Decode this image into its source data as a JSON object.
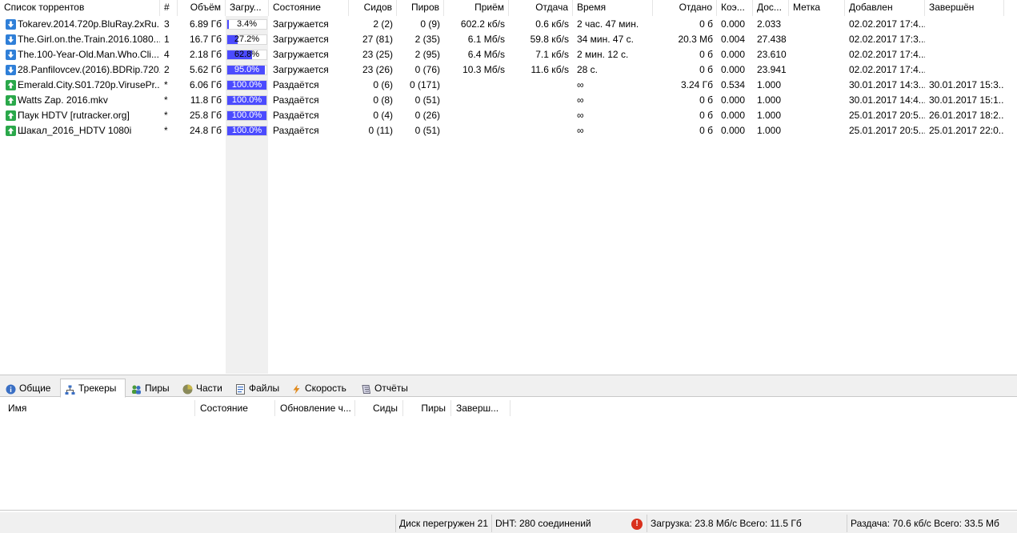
{
  "columns": {
    "name": "Список торрентов",
    "queue": "#",
    "size": "Объём",
    "progress": "Загру...",
    "status": "Состояние",
    "seeds": "Сидов",
    "peers": "Пиров",
    "down_speed": "Приём",
    "up_speed": "Отдача",
    "time": "Время",
    "uploaded": "Отдано",
    "ratio": "Коэ...",
    "avail": "Дос...",
    "label": "Метка",
    "added": "Добавлен",
    "completed": "Завершён"
  },
  "torrents": [
    {
      "name": "Tokarev.2014.720p.BluRay.2xRu...",
      "icon": "download-icon",
      "queue": "3",
      "size": "6.89 Гб",
      "progress": 0.034,
      "progress_text": "3.4%",
      "status": "Загружается",
      "seeds": "2 (2)",
      "peers": "0 (9)",
      "down_speed": "602.2 кб/s",
      "up_speed": "0.6 кб/s",
      "time": "2 час. 47 мин.",
      "uploaded": "0 б",
      "ratio": "0.000",
      "avail": "2.033",
      "label": "",
      "added": "02.02.2017 17:4...",
      "completed": ""
    },
    {
      "name": "The.Girl.on.the.Train.2016.1080...",
      "icon": "download-icon",
      "queue": "1",
      "size": "16.7 Гб",
      "progress": 0.272,
      "progress_text": "27.2%",
      "status": "Загружается",
      "seeds": "27 (81)",
      "peers": "2 (35)",
      "down_speed": "6.1 Мб/s",
      "up_speed": "59.8 кб/s",
      "time": "34 мин. 47 с.",
      "uploaded": "20.3 Мб",
      "ratio": "0.004",
      "avail": "27.438",
      "label": "",
      "added": "02.02.2017 17:3...",
      "completed": ""
    },
    {
      "name": "The.100-Year-Old.Man.Who.Cli...",
      "icon": "download-icon",
      "queue": "4",
      "size": "2.18 Гб",
      "progress": 0.628,
      "progress_text": "62.8%",
      "status": "Загружается",
      "seeds": "23 (25)",
      "peers": "2 (95)",
      "down_speed": "6.4 Мб/s",
      "up_speed": "7.1 кб/s",
      "time": "2 мин. 12 с.",
      "uploaded": "0 б",
      "ratio": "0.000",
      "avail": "23.610",
      "label": "",
      "added": "02.02.2017 17:4...",
      "completed": ""
    },
    {
      "name": "28.Panfilovcev.(2016).BDRip.720...",
      "icon": "download-icon",
      "queue": "2",
      "size": "5.62 Гб",
      "progress": 0.95,
      "progress_text": "95.0%",
      "status": "Загружается",
      "seeds": "23 (26)",
      "peers": "0 (76)",
      "down_speed": "10.3 Мб/s",
      "up_speed": "11.6 кб/s",
      "time": "28 с.",
      "uploaded": "0 б",
      "ratio": "0.000",
      "avail": "23.941",
      "label": "",
      "added": "02.02.2017 17:4...",
      "completed": ""
    },
    {
      "name": "Emerald.City.S01.720p.VirusePr...",
      "icon": "seeding-icon",
      "queue": "*",
      "size": "6.06 Гб",
      "progress": 1.0,
      "progress_text": "100.0%",
      "status": "Раздаётся",
      "seeds": "0 (6)",
      "peers": "0 (171)",
      "down_speed": "",
      "up_speed": "",
      "time": "∞",
      "uploaded": "3.24 Гб",
      "ratio": "0.534",
      "avail": "1.000",
      "label": "",
      "added": "30.01.2017 14:3...",
      "completed": "30.01.2017 15:3..."
    },
    {
      "name": "Watts Zap. 2016.mkv",
      "icon": "seeding-icon",
      "queue": "*",
      "size": "11.8 Гб",
      "progress": 1.0,
      "progress_text": "100.0%",
      "status": "Раздаётся",
      "seeds": "0 (8)",
      "peers": "0 (51)",
      "down_speed": "",
      "up_speed": "",
      "time": "∞",
      "uploaded": "0 б",
      "ratio": "0.000",
      "avail": "1.000",
      "label": "",
      "added": "30.01.2017 14:4...",
      "completed": "30.01.2017 15:1..."
    },
    {
      "name": "Паук HDTV [rutracker.org]",
      "icon": "seeding-icon",
      "queue": "*",
      "size": "25.8 Гб",
      "progress": 1.0,
      "progress_text": "100.0%",
      "status": "Раздаётся",
      "seeds": "0 (4)",
      "peers": "0 (26)",
      "down_speed": "",
      "up_speed": "",
      "time": "∞",
      "uploaded": "0 б",
      "ratio": "0.000",
      "avail": "1.000",
      "label": "",
      "added": "25.01.2017 20:5...",
      "completed": "26.01.2017 18:2..."
    },
    {
      "name": "Шакал_2016_HDTV 1080i",
      "icon": "seeding-icon",
      "queue": "*",
      "size": "24.8 Гб",
      "progress": 1.0,
      "progress_text": "100.0%",
      "status": "Раздаётся",
      "seeds": "0 (11)",
      "peers": "0 (51)",
      "down_speed": "",
      "up_speed": "",
      "time": "∞",
      "uploaded": "0 б",
      "ratio": "0.000",
      "avail": "1.000",
      "label": "",
      "added": "25.01.2017 20:5...",
      "completed": "25.01.2017 22:0..."
    }
  ],
  "tabs": [
    {
      "label": "Общие",
      "icon": "info-icon",
      "active": false
    },
    {
      "label": "Трекеры",
      "icon": "trackers-icon",
      "active": true
    },
    {
      "label": "Пиры",
      "icon": "peers-icon",
      "active": false
    },
    {
      "label": "Части",
      "icon": "pieces-icon",
      "active": false
    },
    {
      "label": "Файлы",
      "icon": "files-icon",
      "active": false
    },
    {
      "label": "Скорость",
      "icon": "speed-icon",
      "active": false
    },
    {
      "label": "Отчёты",
      "icon": "logger-icon",
      "active": false
    }
  ],
  "tracker_columns": {
    "name": "Имя",
    "status": "Состояние",
    "update": "Обновление ч...",
    "seeds": "Сиды",
    "peers": "Пиры",
    "completed": "Заверш..."
  },
  "statusbar": {
    "disk": "Диск перегружен 21",
    "dht": "DHT: 280 соединений",
    "download": "Загрузка: 23.8 Мб/с Всего: 11.5 Гб",
    "upload": "Раздача: 70.6 кб/с Всего: 33.5 Мб"
  },
  "colors": {
    "progress_fill": "#4b4bff",
    "download_icon": "#2f7fd8",
    "seeding_icon": "#2aa84a",
    "warning": "#d9301c"
  }
}
